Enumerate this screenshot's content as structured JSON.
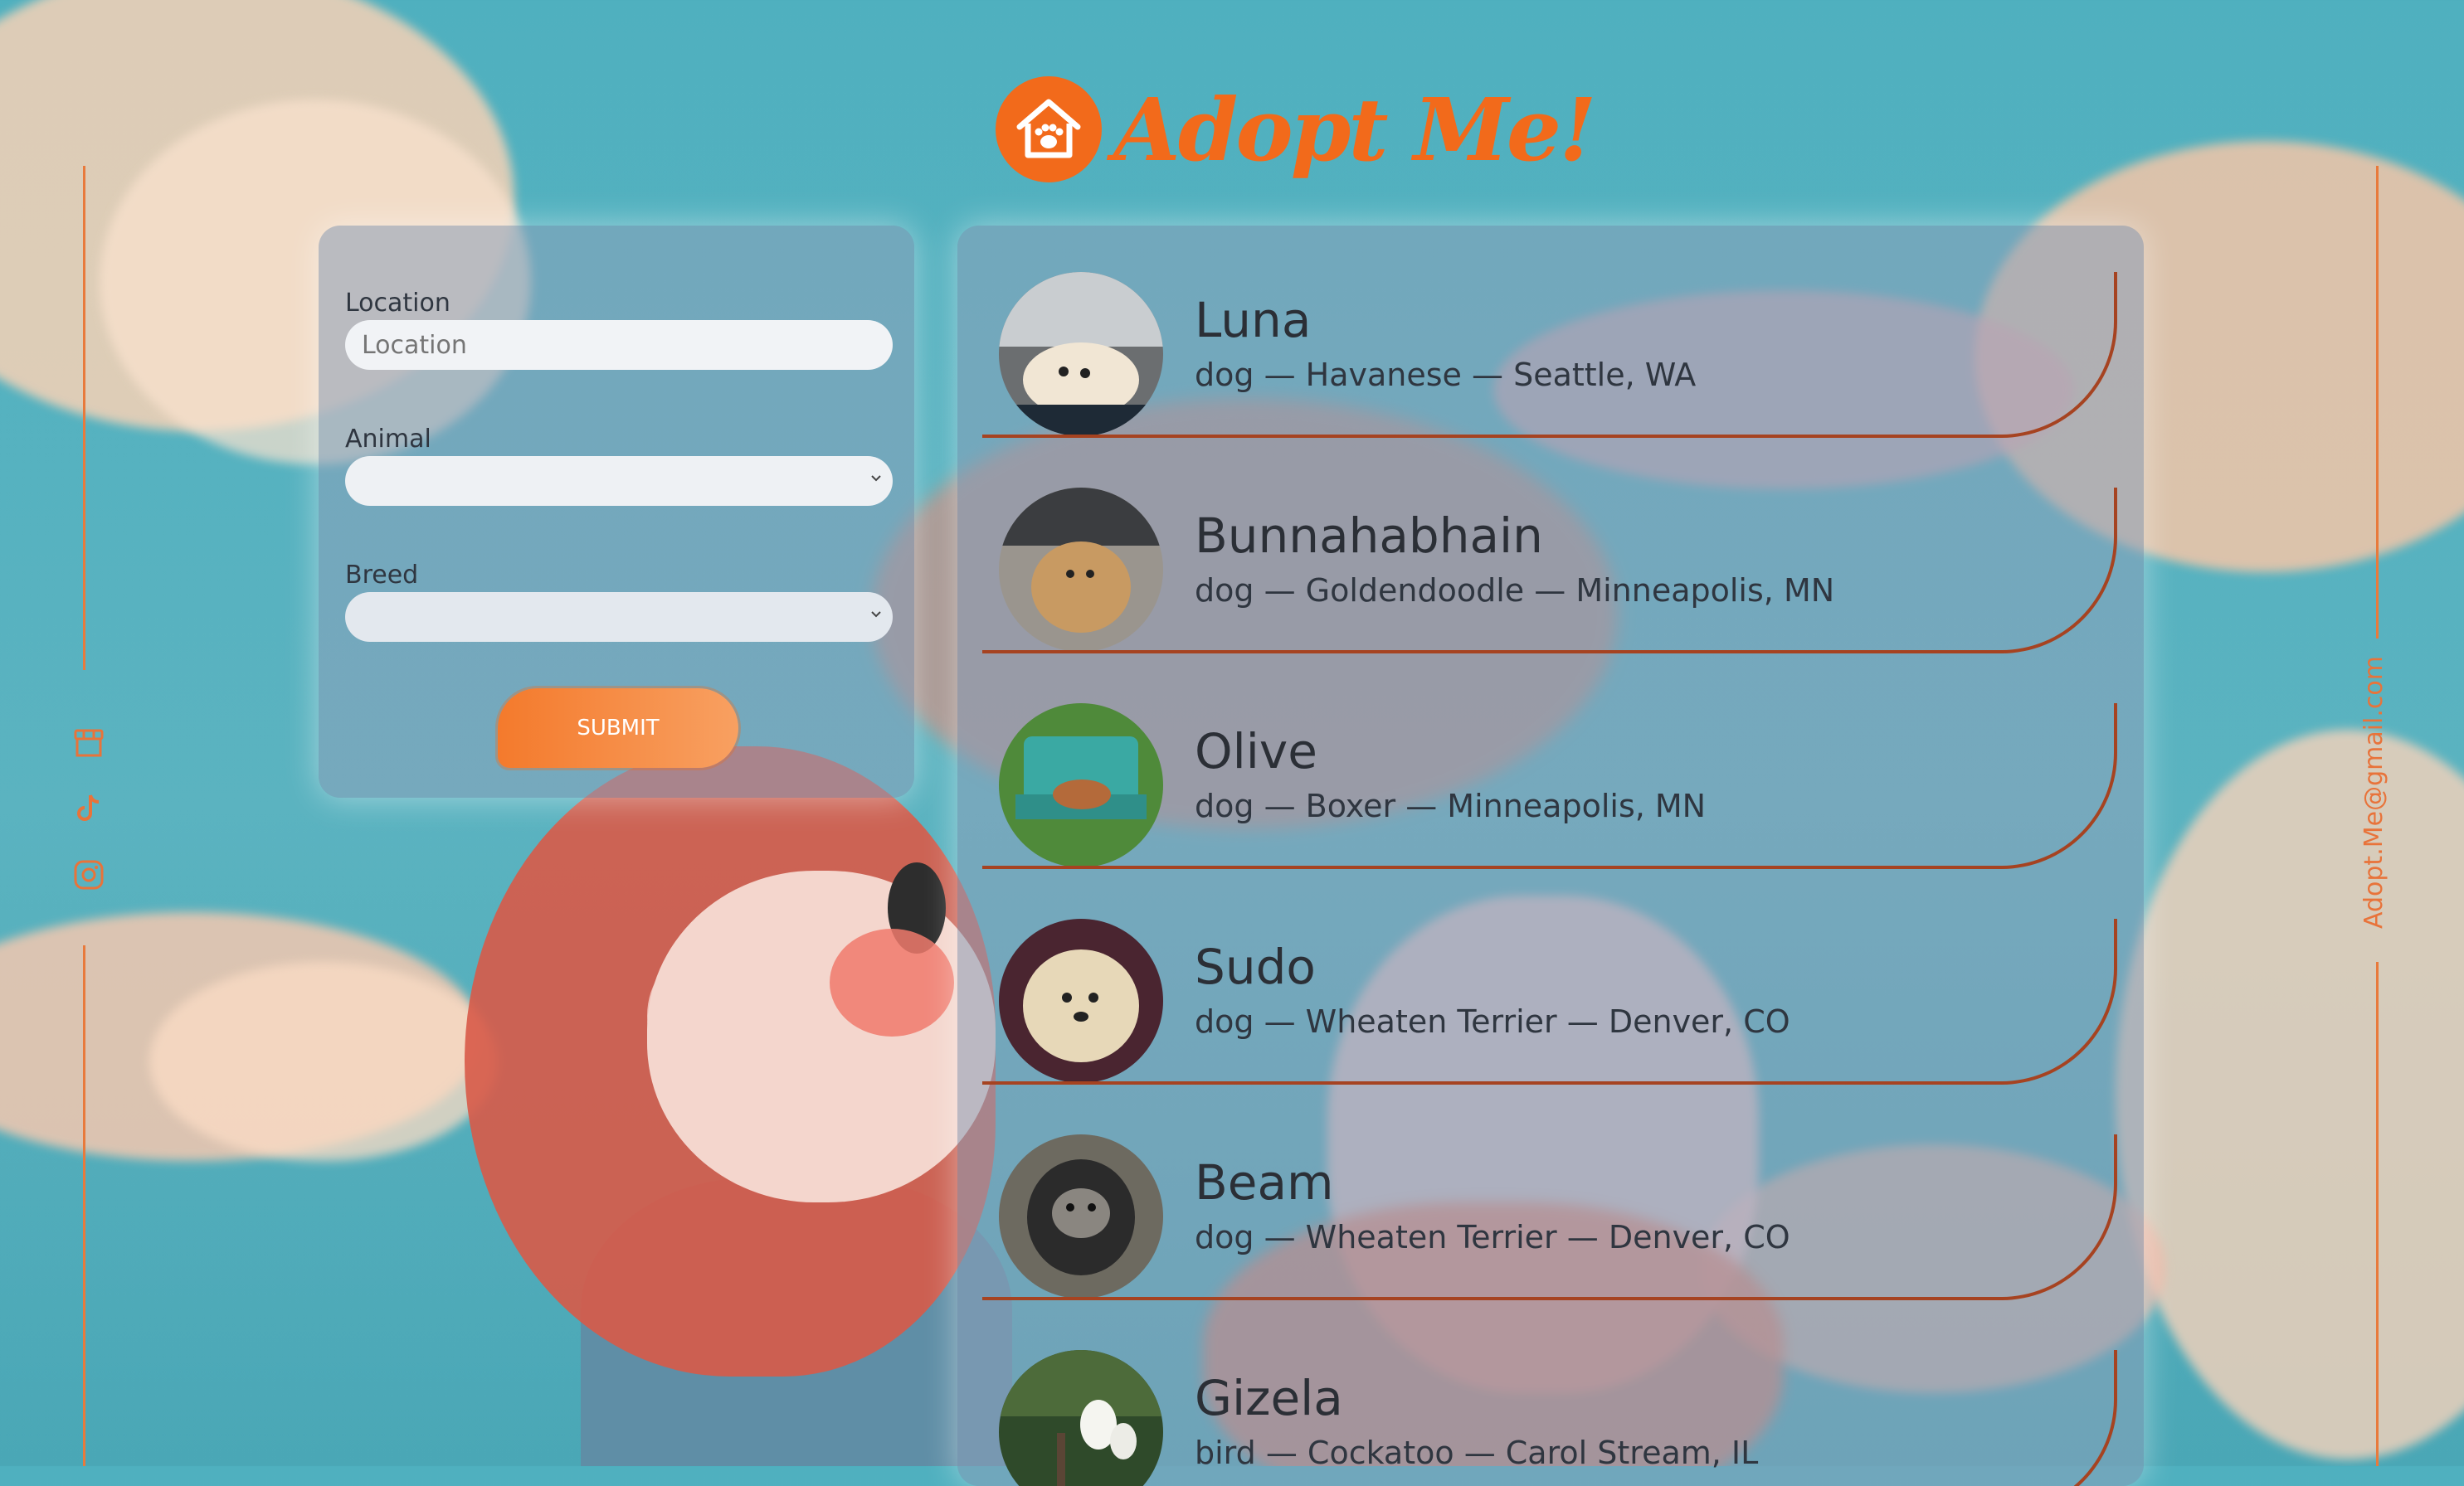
{
  "brand": {
    "title": "Adopt Me!",
    "logo_icon": "house-paw-icon",
    "accent": "#f26a1b"
  },
  "search_form": {
    "location_label": "Location",
    "location_placeholder": "Location",
    "location_value": "",
    "animal_label": "Animal",
    "animal_value": "",
    "breed_label": "Breed",
    "breed_value": "",
    "submit_label": "SUBMIT"
  },
  "pets": [
    {
      "name": "Luna",
      "description": "dog — Havanese — Seattle, WA",
      "avatar": "dog-photo"
    },
    {
      "name": "Bunnahabhain",
      "description": "dog — Goldendoodle — Minneapolis, MN",
      "avatar": "dog-photo"
    },
    {
      "name": "Olive",
      "description": "dog — Boxer — Minneapolis, MN",
      "avatar": "dog-on-bench-photo"
    },
    {
      "name": "Sudo",
      "description": "dog — Wheaten Terrier — Denver, CO",
      "avatar": "dog-photo"
    },
    {
      "name": "Beam",
      "description": "dog — Wheaten Terrier — Denver, CO",
      "avatar": "dog-photo"
    },
    {
      "name": "Gizela",
      "description": "bird — Cockatoo — Carol Stream, IL",
      "avatar": "bird-photo"
    }
  ],
  "social": [
    {
      "icon": "store-icon"
    },
    {
      "icon": "tiktok-icon"
    },
    {
      "icon": "instagram-icon"
    }
  ],
  "contact_email": "Adopt.Me@gmail.com"
}
